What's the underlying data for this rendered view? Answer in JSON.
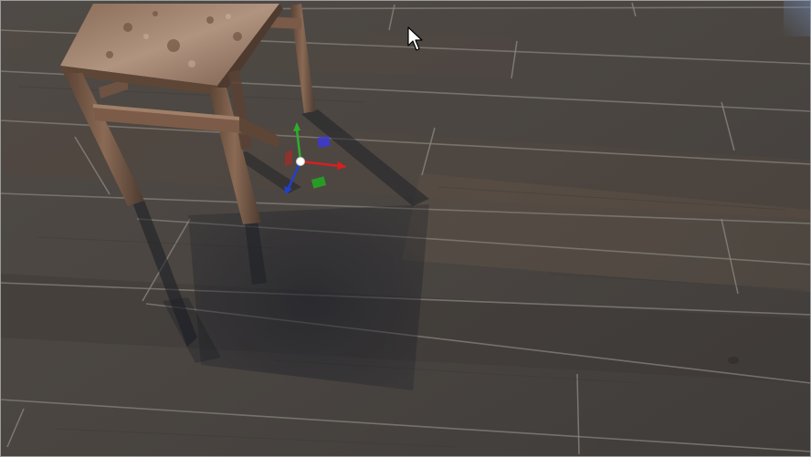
{
  "viewport": {
    "kind": "3d-scene-view",
    "scene": {
      "floor": "wood-plank-floor",
      "objects": [
        "rusty-metal-stool"
      ],
      "light": "directional-light-shadow"
    },
    "gizmo": {
      "type": "translate-gizmo",
      "axes": {
        "x": {
          "color": "#d42020",
          "icon": "x-axis-arrow-icon"
        },
        "y": {
          "color": "#2cb02c",
          "icon": "y-axis-arrow-icon"
        },
        "z": {
          "color": "#2040d0",
          "icon": "z-axis-arrow-icon"
        }
      },
      "planes": {
        "xy": {
          "color": "#3a3ad8"
        },
        "xz": {
          "color": "#22aa22"
        },
        "yz": {
          "color": "#c02020"
        }
      },
      "center_color": "#ffffff"
    },
    "cursor": {
      "icon": "mouse-pointer-icon"
    },
    "colors": {
      "floor_base": "#4a4642",
      "plank_seam": "#7e7a74",
      "stool_rust": "#7a5a46",
      "stool_top": "#a08470",
      "shadow": "#1a1d24",
      "frame_border": "#9c9c9c"
    }
  }
}
